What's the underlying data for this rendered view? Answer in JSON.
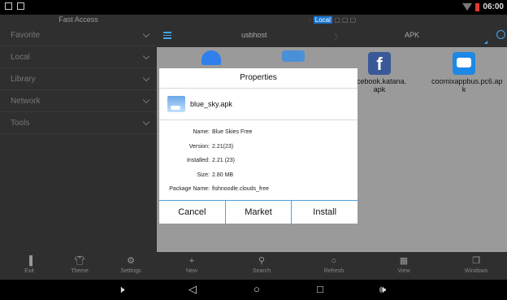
{
  "status_bar": {
    "time": "06:00"
  },
  "sidebar": {
    "title": "Fast Access",
    "items": [
      {
        "label": "Favorite"
      },
      {
        "label": "Local"
      },
      {
        "label": "Library"
      },
      {
        "label": "Network"
      },
      {
        "label": "Tools"
      }
    ]
  },
  "topbar": {
    "breadcrumb_active": "Local",
    "tabs": [
      {
        "label": "usbhost"
      },
      {
        "label": "APK"
      }
    ]
  },
  "files": [
    {
      "name": "acebook.katana.\napk",
      "color": "#3b5998",
      "icon": "facebook-icon"
    },
    {
      "name": "coomixappbus.pc6.ap\nk",
      "color": "#1e88e5",
      "icon": "bus-app-icon"
    }
  ],
  "dialog": {
    "title": "Properties",
    "file_name": "blue_sky.apk",
    "rows": [
      {
        "label": "Name:",
        "value": "Blue Skies Free"
      },
      {
        "label": "Version:",
        "value": "2.21(23)"
      },
      {
        "label": "Installed:",
        "value": "2.21 (23)"
      },
      {
        "label": "Size:",
        "value": "2.80 MB"
      },
      {
        "label": "Package Name:",
        "value": "fishnoodle.clouds_free"
      }
    ],
    "buttons": {
      "cancel": "Cancel",
      "market": "Market",
      "install": "Install"
    }
  },
  "toolbar": {
    "exit": "Exit",
    "theme": "Theme",
    "settings": "Settings",
    "new": "New",
    "search": "Search",
    "refresh": "Refresh",
    "view": "View",
    "windows": "Windows"
  }
}
